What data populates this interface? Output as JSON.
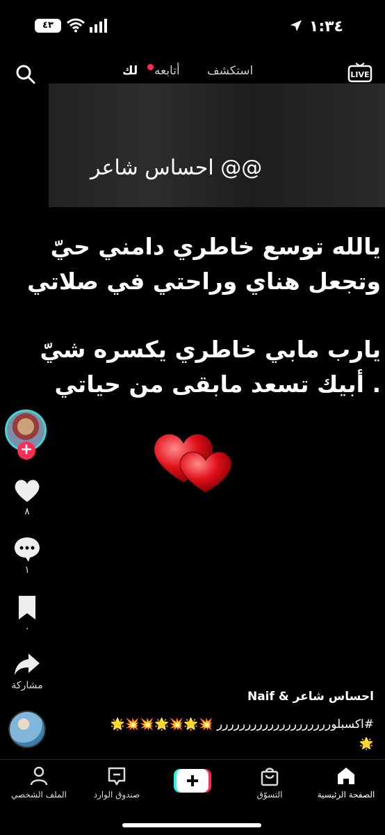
{
  "status_bar": {
    "time": "١:٣٤",
    "battery": "٤٣"
  },
  "top_nav": {
    "live_label": "LIVE",
    "tabs": [
      {
        "label": "استكشف"
      },
      {
        "label": "أتابعه"
      },
      {
        "label": "لك"
      }
    ]
  },
  "video": {
    "title_text": "احساس شاعر @@",
    "poem_stanza_1": [
      "يالله توسع خاطري دامني حيّ",
      "وتجعل هناي وراحتي في صلاتي"
    ],
    "poem_stanza_2": [
      "يارب مابي خاطري يكسره شيّ",
      "أبيك تسعد مابقى من حياتي ."
    ]
  },
  "sidebar": {
    "likes_count": "٨",
    "comments_count": "١",
    "saves_count": "٠",
    "share_label": "مشاركة"
  },
  "caption": {
    "username": "احساس شاعر & Naif",
    "text": "#اكسبلورررررررررررررررررررر 💥🌟💥🌟💥💥🌟 🌟"
  },
  "bottom_nav": [
    {
      "label": "الصفحة الرئيسية"
    },
    {
      "label": "التسوّق"
    },
    {
      "label": "صندوق الوارد"
    },
    {
      "label": "الملف الشخصي"
    }
  ],
  "colors": {
    "accent": "#fe2c55",
    "cyan": "#25f4ee",
    "avatar_ring": "#3fd6d6"
  }
}
